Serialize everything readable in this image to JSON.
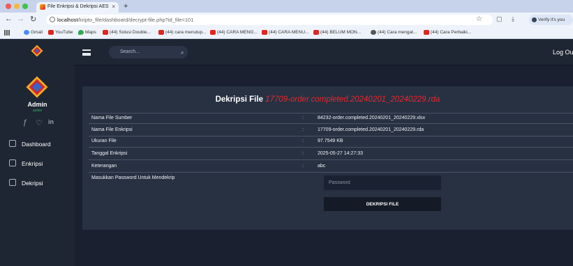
{
  "browser": {
    "tab_title": "File Enkripsi & Dekripsi AES",
    "tab_close": "×",
    "new_tab": "+",
    "url_host": "localhost",
    "url_path": "/kripto_file/dashboard/decrypt-file.php?id_file=101",
    "profile_label": "Verify it's you",
    "bookmarks": [
      {
        "label": "Gmail",
        "icon": "gmail-icon"
      },
      {
        "label": "YouTube",
        "icon": "youtube-icon"
      },
      {
        "label": "Maps",
        "icon": "maps-icon"
      },
      {
        "label": "(44) Solusi Double...",
        "icon": "youtube-icon"
      },
      {
        "label": "(44) cara menutup...",
        "icon": "youtube-icon"
      },
      {
        "label": "(44) CARA MENG...",
        "icon": "youtube-icon"
      },
      {
        "label": "(44) CARA MENU...",
        "icon": "youtube-icon"
      },
      {
        "label": "(44) BELUM MON...",
        "icon": "youtube-icon"
      },
      {
        "label": "(44) Cara mengat...",
        "icon": "chrome-icon"
      },
      {
        "label": "(44) Cara Perbaiki...",
        "icon": "youtube-icon"
      }
    ]
  },
  "sidebar": {
    "user_name": "Admin",
    "user_status": "active",
    "social": [
      "facebook-icon",
      "twitter-icon",
      "linkedin-icon"
    ],
    "items": [
      {
        "label": "Dashboard",
        "icon": "home-icon"
      },
      {
        "label": "Enkripsi",
        "icon": "lock-icon"
      },
      {
        "label": "Dekripsi",
        "icon": "lock-icon"
      }
    ]
  },
  "header": {
    "search_placeholder": "Search...",
    "logout": "Log Out"
  },
  "card": {
    "title_prefix": "Dekripsi File",
    "title_file": "17709-order.completed.20240201_20240229.rda",
    "rows": [
      {
        "label": "Nama File Sumber",
        "value": "84232-order.completed.20240201_20240229.xlsx"
      },
      {
        "label": "Nama File Enkripsi",
        "value": "17709-order.completed.20240201_20240229.rda"
      },
      {
        "label": "Ukuran File",
        "value": "97.7549 KB"
      },
      {
        "label": "Tanggal Enkripsi",
        "value": "2025-05-27 14:27:33"
      },
      {
        "label": "Keterangan",
        "value": "abc"
      }
    ],
    "separator": ":",
    "password_label": "Masukkan Password Untuk Mendekrip",
    "password_placeholder": "Password",
    "decrypt_button": "DEKRIPSI FILE"
  },
  "colors": {
    "accent_red": "#e8262b",
    "sidebar_bg": "#1e2633",
    "card_bg": "#273142"
  }
}
